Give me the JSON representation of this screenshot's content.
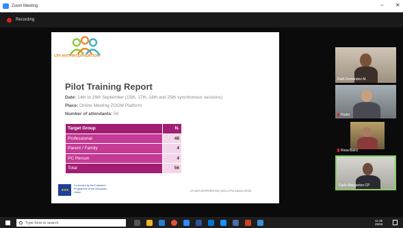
{
  "window": {
    "title": "Zoom Meeting",
    "min_glyph": "−",
    "close_glyph": "✕"
  },
  "recording": {
    "label": "Recording"
  },
  "slide": {
    "logo_text": "CPI-ANTI-INTERVENTION",
    "title": "Pilot Training Report",
    "date_label": "Date:",
    "date_value": "14th to 29th September (15th, 17th, 18th and 25th synchronous sessions)",
    "place_label": "Place:",
    "place_value": "Online Meeting ZOOM Platform",
    "attendants_label": "Number of attendants:",
    "attendants_value": "56",
    "table": {
      "header": [
        "Target Group",
        "N."
      ],
      "rows": [
        [
          "Professional",
          "48"
        ],
        [
          "Parent / Family",
          "4"
        ],
        [
          "PC Person",
          "4"
        ],
        [
          "Total",
          "56"
        ]
      ]
    },
    "eu_text": "Co-funded by the Erasmus+ Programme of the European Union",
    "footer_code": "CPI-ANTI-INTERVENTION_2020-1-PT01-KA204-078754",
    "colors": {
      "header": "#a01e73",
      "row": "#c43a94",
      "value_bg": "#f4d6ea"
    }
  },
  "participants": [
    {
      "name": "Ruth Fernández M.",
      "muted": false
    },
    {
      "name": "Pedro",
      "muted": true
    },
    {
      "name": "Rosa Baird",
      "muted": true
    },
    {
      "name": "Carla Margarites CP",
      "muted": false,
      "active_speaker": true
    }
  ],
  "taskbar": {
    "search_placeholder": "Type here to search",
    "time": "11:36",
    "date": "29/09"
  }
}
